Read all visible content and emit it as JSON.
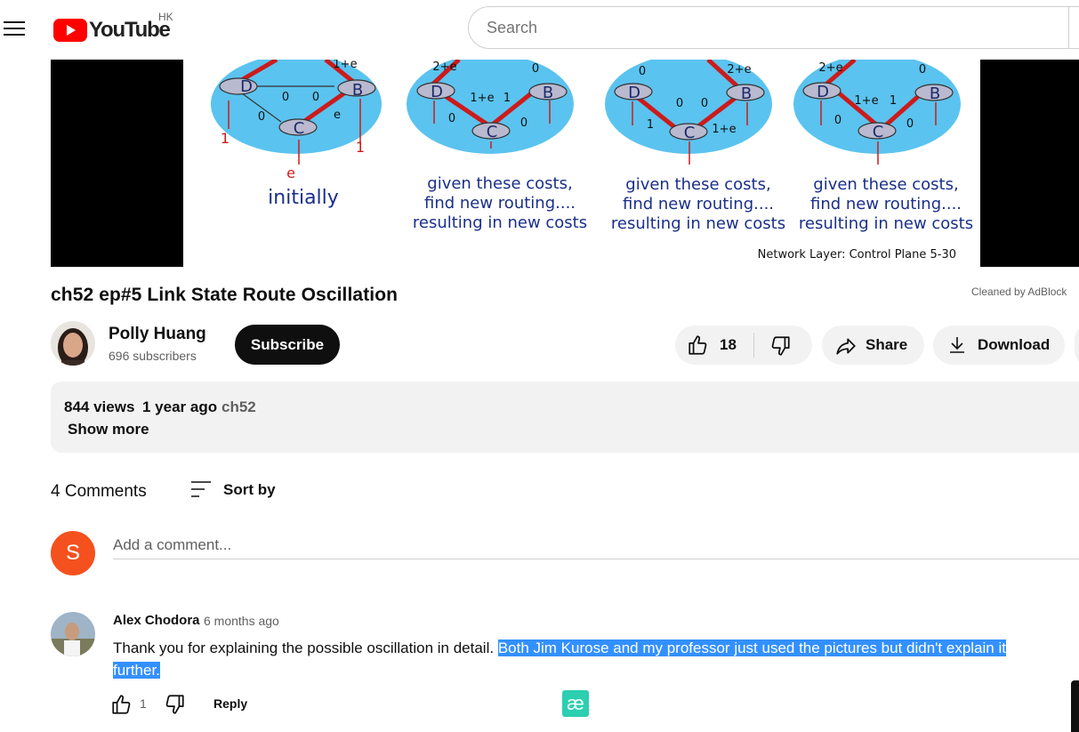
{
  "header": {
    "logo_text": "YouTube",
    "region": "HK",
    "search_placeholder": "Search"
  },
  "video": {
    "slide": {
      "captions": [
        "initially",
        "given these costs,",
        "find new routing....",
        "resulting in new costs"
      ],
      "footer": "Network Layer: Control Plane  5-30",
      "nodes": [
        "D",
        "B",
        "C"
      ],
      "panel1_labels": [
        "1+e",
        "0",
        "0",
        "0",
        "e",
        "1",
        "1",
        "e"
      ],
      "panel2_labels": [
        "2+e",
        "0",
        "1+e",
        "1",
        "0",
        "0"
      ],
      "panel3_labels": [
        "0",
        "2+e",
        "0",
        "0",
        "1",
        "1+e"
      ],
      "panel4_labels": [
        "2+e",
        "0",
        "1+e",
        "1",
        "0",
        "0"
      ]
    },
    "title": "ch52 ep#5 Link State Route Oscillation",
    "adblock_note": "Cleaned by AdBlock"
  },
  "channel": {
    "name": "Polly Huang",
    "subscribers": "696 subscribers",
    "subscribe_label": "Subscribe"
  },
  "actions": {
    "like_count": "18",
    "share_label": "Share",
    "download_label": "Download"
  },
  "description": {
    "views": "844 views",
    "time": "1 year ago",
    "tag": "ch52",
    "show_more": "Show more"
  },
  "comments": {
    "count_label": "4 Comments",
    "sort_label": "Sort by",
    "user_initial": "S",
    "add_placeholder": "Add a comment...",
    "items": [
      {
        "author": "Alex Chodora",
        "time": "6 months ago",
        "text_plain": "Thank you for explaining the possible oscillation in detail. ",
        "text_highlighted": "Both Jim Kurose and my professor just used the pictures but didn't explain it further.",
        "likes": "1",
        "reply_label": "Reply"
      }
    ]
  },
  "overlay": {
    "badge_glyph": "æ"
  }
}
